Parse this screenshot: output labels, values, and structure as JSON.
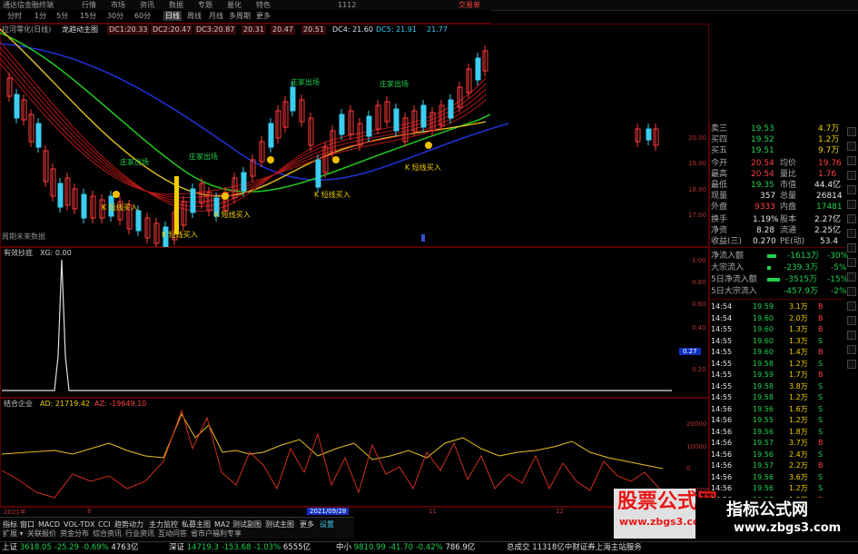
{
  "window": {
    "title": "通达信金融终端",
    "menu": [
      "行情",
      "市场",
      "资讯",
      "数据",
      "专题",
      "量化",
      "特色",
      "1112"
    ],
    "right_link": "交易单"
  },
  "toolbar": {
    "items": [
      "分时",
      "1分",
      "5分",
      "15分",
      "30分",
      "60分",
      "日线",
      "周线",
      "月线",
      "多周期",
      "更多"
    ],
    "active": "日线"
  },
  "main_chart": {
    "title": "拉河零化(日线)",
    "indicator": "龙趋动主图",
    "readouts": [
      {
        "text": "DC1:20.33",
        "color": "#ff3030"
      },
      {
        "text": "DC2:20.47",
        "color": "#ff3030"
      },
      {
        "text": "DC3:20.87",
        "color": "#ff3030"
      },
      {
        "text": "20.31",
        "color": "#ff3030"
      },
      {
        "text": "20.47",
        "color": "#ff3030"
      },
      {
        "text": "20.51",
        "color": "#ff3030"
      },
      {
        "text": "DC4: 21.60",
        "color": "#e0e0e0"
      },
      {
        "text": "DC5: 21.91",
        "color": "#3ccdf0"
      },
      {
        "text": "21.77",
        "color": "#3ccdf0"
      }
    ],
    "axis_labels": [
      "20.00",
      "19.00",
      "18.00",
      "17.00"
    ],
    "signals": [
      {
        "text": "庄家出场",
        "color": "#21d04f"
      },
      {
        "text": "庄家出场",
        "color": "#21d04f"
      },
      {
        "text": "庄家出场",
        "color": "#21d04f"
      },
      {
        "text": "庄家出场",
        "color": "#21d04f"
      }
    ],
    "buy_signals": [
      "K 短线买入",
      "K 短线买入",
      "K 短线买入",
      "K 短线买入",
      "K 短线买入"
    ],
    "footnote": "周期未来数据"
  },
  "panel2": {
    "title": "有效抄底",
    "value_label": "XG: 0.00",
    "axis_labels": [
      "1.00",
      "0.80",
      "0.60",
      "0.40",
      "0.27",
      "0.20"
    ]
  },
  "panel3": {
    "title": "结合企业",
    "ad": "AD: 21719.42",
    "az": "AZ: -19649.10",
    "axis_labels": [
      "20000",
      "10000",
      "0",
      "-10000"
    ]
  },
  "time_axis": {
    "labels": [
      "2021年",
      "8",
      "2021/09/28",
      "11",
      "12"
    ]
  },
  "quote": {
    "rows": [
      {
        "label": "卖三",
        "price": "19.53",
        "vol": "4.7万"
      },
      {
        "label": "买四",
        "price": "19.52",
        "vol": "1.2万"
      },
      {
        "label": "买五",
        "price": "19.51",
        "vol": "9.7万"
      },
      {
        "label": "今开",
        "price": "20.54",
        "vol2_label": "均价",
        "vol2": "19.76"
      },
      {
        "label": "最高",
        "price": "20.54",
        "vol2_label": "量比",
        "vol2": "1.76"
      },
      {
        "label": "最低",
        "price": "19.35",
        "vol2_label": "市值",
        "vol2": "44.4亿"
      },
      {
        "label": "现量",
        "price": "357",
        "vol2_label": "总量",
        "vol2": "26814"
      },
      {
        "label": "外盘",
        "price": "9333",
        "vol2_label": "内盘",
        "vol2": "17481"
      },
      {
        "label": "换手",
        "price": "1.19%",
        "vol2_label": "股本",
        "vol2": "2.27亿"
      },
      {
        "label": "净资",
        "price": "8.28",
        "vol2_label": "流通",
        "vol2": "2.25亿"
      },
      {
        "label": "收益(三)",
        "price": "0.270",
        "vol2_label": "PE(动)",
        "vol2": "53.4"
      }
    ],
    "flows": [
      {
        "label": "净流入额",
        "value": "-1613万",
        "pct": "-30%"
      },
      {
        "label": "大宗流入",
        "value": "-239.3万",
        "pct": "-5%"
      },
      {
        "label": "5日净流入额",
        "value": "-3515万",
        "pct": "-15%"
      },
      {
        "label": "5日大宗流入",
        "value": "-457.9万",
        "pct": "-2%"
      }
    ],
    "trades": [
      {
        "t": "14:54",
        "p": "19.59",
        "v": "3.1万",
        "s": "B"
      },
      {
        "t": "14:54",
        "p": "19.60",
        "v": "2.0万",
        "s": "B"
      },
      {
        "t": "14:55",
        "p": "19.60",
        "v": "1.3万",
        "s": "B"
      },
      {
        "t": "14:55",
        "p": "19.60",
        "v": "1.3万",
        "s": "S"
      },
      {
        "t": "14:55",
        "p": "19.60",
        "v": "1.4万",
        "s": "B"
      },
      {
        "t": "14:55",
        "p": "19.58",
        "v": "1.2万",
        "s": "S"
      },
      {
        "t": "14:55",
        "p": "19.59",
        "v": "1.7万",
        "s": "B"
      },
      {
        "t": "14:55",
        "p": "19.58",
        "v": "3.8万",
        "s": "S"
      },
      {
        "t": "14:55",
        "p": "19.58",
        "v": "1.2万",
        "s": "S"
      },
      {
        "t": "14:56",
        "p": "19.56",
        "v": "1.6万",
        "s": "S"
      },
      {
        "t": "14:56",
        "p": "19.55",
        "v": "1.2万",
        "s": "S"
      },
      {
        "t": "14:56",
        "p": "19.56",
        "v": "1.8万",
        "s": "S"
      },
      {
        "t": "14:56",
        "p": "19.57",
        "v": "3.7万",
        "s": "B"
      },
      {
        "t": "14:56",
        "p": "19.56",
        "v": "2.4万",
        "s": "S"
      },
      {
        "t": "14:56",
        "p": "19.57",
        "v": "2.2万",
        "s": "B"
      },
      {
        "t": "14:56",
        "p": "19.56",
        "v": "3.6万",
        "s": "S"
      },
      {
        "t": "14:56",
        "p": "19.56",
        "v": "1.2万",
        "s": "S"
      },
      {
        "t": "14:56",
        "p": "19.57",
        "v": "1.5万",
        "s": "B"
      }
    ]
  },
  "bottom_tabs": [
    "指标",
    "窗口",
    "MACD",
    "VOL-TDX",
    "CCI",
    "趋势动力",
    "主力监控",
    "私募主图",
    "MA2",
    "测试副图",
    "测试主图",
    "更多",
    "设置"
  ],
  "bottom_tabs2": [
    "扩展 ▾",
    "关联报价",
    "资金分布",
    "综合资讯",
    "行业资讯",
    "互动问答",
    "省市户福利专享"
  ],
  "status": [
    {
      "label": "上证",
      "value": "3618.05",
      "chg": "-25.29",
      "pct": "-0.69%",
      "amt": "4763亿"
    },
    {
      "label": "深证",
      "value": "14719.3",
      "chg": "-153.68",
      "pct": "-1.03%",
      "amt": "6555亿"
    },
    {
      "label": "中小",
      "value": "9810.99",
      "chg": "-41.70",
      "pct": "-0.42%",
      "amt": "786.9亿"
    }
  ],
  "status_tail": "总成交 11318亿中财证券上海主站服务",
  "watermark": {
    "brand": "股票公式网",
    "url": "www.zbgs3.com",
    "side": "指标公式网"
  },
  "colors": {
    "up": "#ff4040",
    "down": "#21d04f",
    "frame": "#5a0000",
    "ma_blue": "#2030d0",
    "ma_green": "#20c020",
    "ma_yellow": "#e8c020"
  }
}
